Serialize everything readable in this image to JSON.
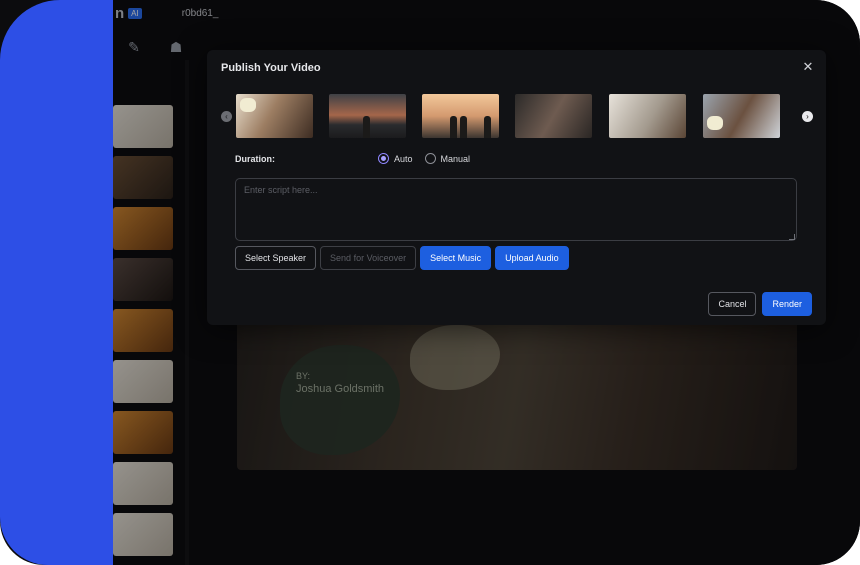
{
  "background_app": {
    "logo_fragment": "n",
    "logo_tag": "AI",
    "project_name": "r0bd61_",
    "byline_label": "BY:",
    "byline_name": "Joshua Goldsmith"
  },
  "modal": {
    "title": "Publish Your Video",
    "close_symbol": "✕",
    "carousel": {
      "prev_symbol": "‹",
      "next_symbol": "›",
      "slides": [
        "slide-1",
        "slide-2",
        "slide-3",
        "slide-4",
        "slide-5",
        "slide-6"
      ]
    },
    "duration": {
      "label": "Duration:",
      "options": [
        "Auto",
        "Manual"
      ],
      "selected": "Auto"
    },
    "script": {
      "placeholder": "Enter script here...",
      "value": ""
    },
    "actions": {
      "select_speaker": "Select Speaker",
      "send_for_voiceover": "Send for Voiceover",
      "select_music": "Select Music",
      "upload_audio": "Upload Audio"
    },
    "footer": {
      "cancel": "Cancel",
      "render": "Render"
    }
  },
  "colors": {
    "accent_blue": "#1d5fe0",
    "side_strip": "#2d4fe6",
    "radio_selected": "#a7a0ff",
    "modal_bg": "#111215"
  },
  "icons": {
    "edit": "edit-icon",
    "people": "people-icon",
    "close": "close-icon",
    "prev": "chevron-left-icon",
    "next": "chevron-right-icon"
  }
}
